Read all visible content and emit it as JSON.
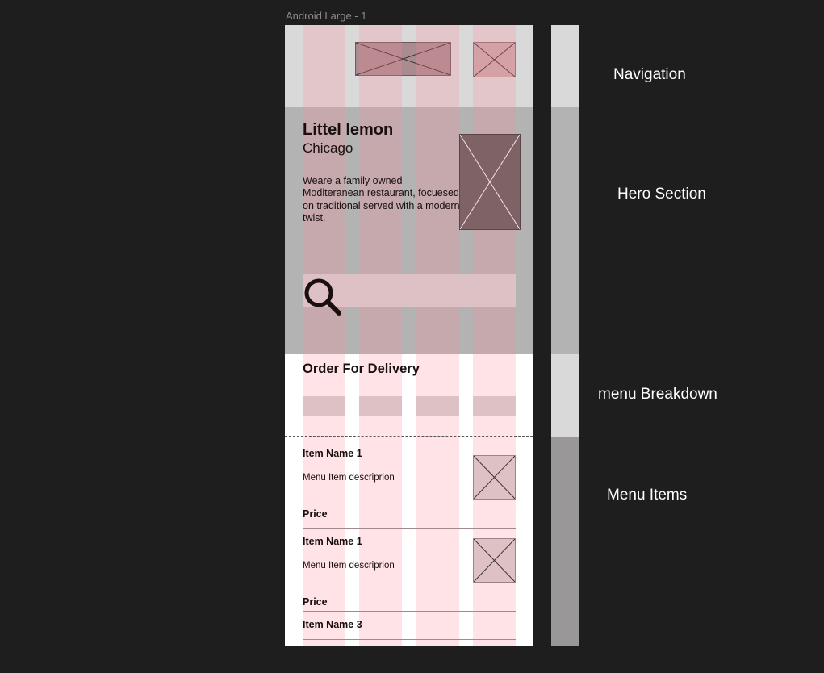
{
  "frame": {
    "label": "Android Large - 1"
  },
  "hero": {
    "title": "Littel lemon",
    "city": "Chicago",
    "description": "Weare a family owned Moditeranean restaurant, focuesed on traditional served with a modern twist.",
    "search_icon": "search-icon"
  },
  "order": {
    "title": "Order For Delivery"
  },
  "menu_items": [
    {
      "name": "Item Name 1",
      "description": "Menu Item descriprion",
      "price": "Price"
    },
    {
      "name": "Item Name 1",
      "description": "Menu Item descriprion",
      "price": "Price"
    },
    {
      "name": "Item Name 3"
    }
  ],
  "sections": {
    "navigation": "Navigation",
    "hero": "Hero Section",
    "menu_breakdown": "menu Breakdown",
    "menu_items": "Menu Items"
  },
  "colors": {
    "background": "#1e1e1e",
    "grid_column": "#ff8c96",
    "navigation": "#d9d9d9",
    "hero": "#b3b3b3",
    "menu_items_bar": "#999797"
  }
}
